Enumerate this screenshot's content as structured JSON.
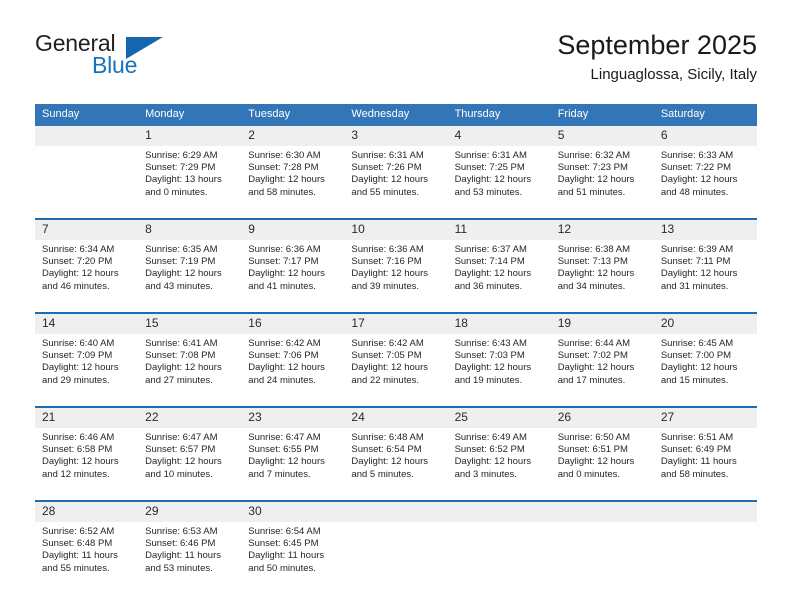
{
  "brand": {
    "name_part1": "General",
    "name_part2": "Blue",
    "mark": "triangle-flag"
  },
  "header": {
    "title": "September 2025",
    "subtitle": "Linguaglossa, Sicily, Italy"
  },
  "colors": {
    "header_blue": "#3376b8",
    "rule_blue": "#1f6bb0",
    "daynum_band": "#efefef",
    "brand_blue": "#1673bd"
  },
  "weekday_headers": [
    "Sunday",
    "Monday",
    "Tuesday",
    "Wednesday",
    "Thursday",
    "Friday",
    "Saturday"
  ],
  "weeks": [
    {
      "days": [
        {
          "num": "",
          "lines": []
        },
        {
          "num": "1",
          "lines": [
            "Sunrise: 6:29 AM",
            "Sunset: 7:29 PM",
            "Daylight: 13 hours",
            "and 0 minutes."
          ]
        },
        {
          "num": "2",
          "lines": [
            "Sunrise: 6:30 AM",
            "Sunset: 7:28 PM",
            "Daylight: 12 hours",
            "and 58 minutes."
          ]
        },
        {
          "num": "3",
          "lines": [
            "Sunrise: 6:31 AM",
            "Sunset: 7:26 PM",
            "Daylight: 12 hours",
            "and 55 minutes."
          ]
        },
        {
          "num": "4",
          "lines": [
            "Sunrise: 6:31 AM",
            "Sunset: 7:25 PM",
            "Daylight: 12 hours",
            "and 53 minutes."
          ]
        },
        {
          "num": "5",
          "lines": [
            "Sunrise: 6:32 AM",
            "Sunset: 7:23 PM",
            "Daylight: 12 hours",
            "and 51 minutes."
          ]
        },
        {
          "num": "6",
          "lines": [
            "Sunrise: 6:33 AM",
            "Sunset: 7:22 PM",
            "Daylight: 12 hours",
            "and 48 minutes."
          ]
        }
      ]
    },
    {
      "days": [
        {
          "num": "7",
          "lines": [
            "Sunrise: 6:34 AM",
            "Sunset: 7:20 PM",
            "Daylight: 12 hours",
            "and 46 minutes."
          ]
        },
        {
          "num": "8",
          "lines": [
            "Sunrise: 6:35 AM",
            "Sunset: 7:19 PM",
            "Daylight: 12 hours",
            "and 43 minutes."
          ]
        },
        {
          "num": "9",
          "lines": [
            "Sunrise: 6:36 AM",
            "Sunset: 7:17 PM",
            "Daylight: 12 hours",
            "and 41 minutes."
          ]
        },
        {
          "num": "10",
          "lines": [
            "Sunrise: 6:36 AM",
            "Sunset: 7:16 PM",
            "Daylight: 12 hours",
            "and 39 minutes."
          ]
        },
        {
          "num": "11",
          "lines": [
            "Sunrise: 6:37 AM",
            "Sunset: 7:14 PM",
            "Daylight: 12 hours",
            "and 36 minutes."
          ]
        },
        {
          "num": "12",
          "lines": [
            "Sunrise: 6:38 AM",
            "Sunset: 7:13 PM",
            "Daylight: 12 hours",
            "and 34 minutes."
          ]
        },
        {
          "num": "13",
          "lines": [
            "Sunrise: 6:39 AM",
            "Sunset: 7:11 PM",
            "Daylight: 12 hours",
            "and 31 minutes."
          ]
        }
      ]
    },
    {
      "days": [
        {
          "num": "14",
          "lines": [
            "Sunrise: 6:40 AM",
            "Sunset: 7:09 PM",
            "Daylight: 12 hours",
            "and 29 minutes."
          ]
        },
        {
          "num": "15",
          "lines": [
            "Sunrise: 6:41 AM",
            "Sunset: 7:08 PM",
            "Daylight: 12 hours",
            "and 27 minutes."
          ]
        },
        {
          "num": "16",
          "lines": [
            "Sunrise: 6:42 AM",
            "Sunset: 7:06 PM",
            "Daylight: 12 hours",
            "and 24 minutes."
          ]
        },
        {
          "num": "17",
          "lines": [
            "Sunrise: 6:42 AM",
            "Sunset: 7:05 PM",
            "Daylight: 12 hours",
            "and 22 minutes."
          ]
        },
        {
          "num": "18",
          "lines": [
            "Sunrise: 6:43 AM",
            "Sunset: 7:03 PM",
            "Daylight: 12 hours",
            "and 19 minutes."
          ]
        },
        {
          "num": "19",
          "lines": [
            "Sunrise: 6:44 AM",
            "Sunset: 7:02 PM",
            "Daylight: 12 hours",
            "and 17 minutes."
          ]
        },
        {
          "num": "20",
          "lines": [
            "Sunrise: 6:45 AM",
            "Sunset: 7:00 PM",
            "Daylight: 12 hours",
            "and 15 minutes."
          ]
        }
      ]
    },
    {
      "days": [
        {
          "num": "21",
          "lines": [
            "Sunrise: 6:46 AM",
            "Sunset: 6:58 PM",
            "Daylight: 12 hours",
            "and 12 minutes."
          ]
        },
        {
          "num": "22",
          "lines": [
            "Sunrise: 6:47 AM",
            "Sunset: 6:57 PM",
            "Daylight: 12 hours",
            "and 10 minutes."
          ]
        },
        {
          "num": "23",
          "lines": [
            "Sunrise: 6:47 AM",
            "Sunset: 6:55 PM",
            "Daylight: 12 hours",
            "and 7 minutes."
          ]
        },
        {
          "num": "24",
          "lines": [
            "Sunrise: 6:48 AM",
            "Sunset: 6:54 PM",
            "Daylight: 12 hours",
            "and 5 minutes."
          ]
        },
        {
          "num": "25",
          "lines": [
            "Sunrise: 6:49 AM",
            "Sunset: 6:52 PM",
            "Daylight: 12 hours",
            "and 3 minutes."
          ]
        },
        {
          "num": "26",
          "lines": [
            "Sunrise: 6:50 AM",
            "Sunset: 6:51 PM",
            "Daylight: 12 hours",
            "and 0 minutes."
          ]
        },
        {
          "num": "27",
          "lines": [
            "Sunrise: 6:51 AM",
            "Sunset: 6:49 PM",
            "Daylight: 11 hours",
            "and 58 minutes."
          ]
        }
      ]
    },
    {
      "days": [
        {
          "num": "28",
          "lines": [
            "Sunrise: 6:52 AM",
            "Sunset: 6:48 PM",
            "Daylight: 11 hours",
            "and 55 minutes."
          ]
        },
        {
          "num": "29",
          "lines": [
            "Sunrise: 6:53 AM",
            "Sunset: 6:46 PM",
            "Daylight: 11 hours",
            "and 53 minutes."
          ]
        },
        {
          "num": "30",
          "lines": [
            "Sunrise: 6:54 AM",
            "Sunset: 6:45 PM",
            "Daylight: 11 hours",
            "and 50 minutes."
          ]
        },
        {
          "num": "",
          "lines": []
        },
        {
          "num": "",
          "lines": []
        },
        {
          "num": "",
          "lines": []
        },
        {
          "num": "",
          "lines": []
        }
      ]
    }
  ]
}
